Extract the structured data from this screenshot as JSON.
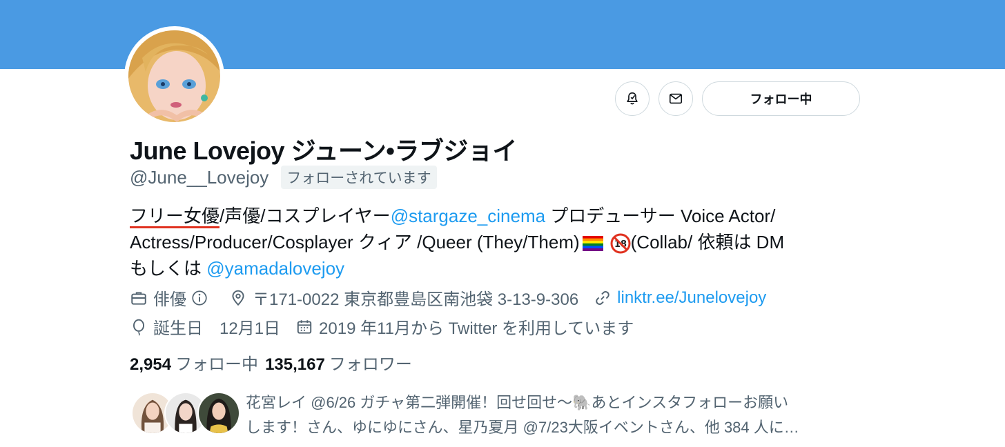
{
  "colors": {
    "banner": "#4a9ae3",
    "link": "#1d9bf0",
    "secondary_text": "#536471",
    "border": "#cfd9de",
    "underline": "#e0311f"
  },
  "header": {
    "follow_button_label": "フォロー中",
    "notification_icon": "bell-icon",
    "message_icon": "envelope-icon"
  },
  "profile": {
    "display_name": "June Lovejoy ジューン•ラブジョイ",
    "handle": "@June__Lovejoy",
    "follows_you_badge": "フォローされています",
    "bio": {
      "line1_a": "フリー女優",
      "line1_b": "/声優/コスプレイヤー",
      "line1_mention": "@stargaze_cinema",
      "line1_c": " プロデューサー Voice Actor/",
      "line2_a": "Actress/Producer/Cosplayer クィア /Queer (They/Them)",
      "line2_b": "(Collab/ 依頼は DM",
      "line3_a": "もしくは ",
      "line3_mention": "@yamadalovejoy"
    },
    "category": "俳優",
    "location": "〒171-0022 東京都豊島区南池袋 3-13-9-306",
    "website": "linktr.ee/Junelovejoy",
    "birthday_label": "誕生日",
    "birthday_value": "12月1日",
    "joined": "2019 年11月から Twitter を利用しています"
  },
  "stats": {
    "following_count": "2,954",
    "following_label": "フォロー中",
    "followers_count": "135,167",
    "followers_label": "フォロワー"
  },
  "followers_you_know": {
    "line1": "花宮レイ @6/26 ガチャ第二弾開催！回せ回せ〜🐘あとインスタフォローお願い",
    "line2": "します！さん、ゆにゆにさん、星乃夏月 @7/23大阪イベントさん、他 384 人に…"
  }
}
